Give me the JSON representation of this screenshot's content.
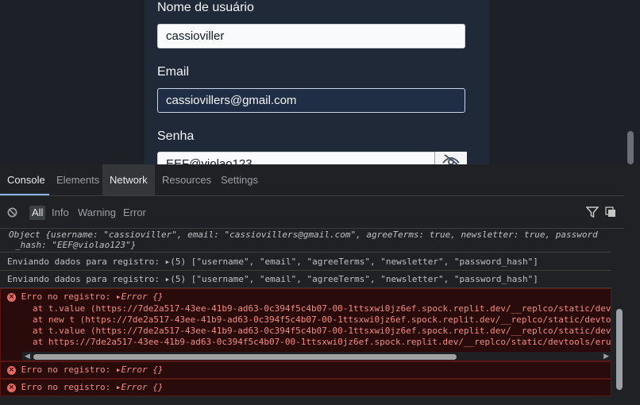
{
  "form": {
    "username_label": "Nome de usuário",
    "username_value": "cassioviller",
    "email_label": "Email",
    "email_value": "cassiovillers@gmail.com",
    "password_label": "Senha",
    "password_value": "EEF@violao123"
  },
  "devtools": {
    "tabs": [
      "Console",
      "Elements",
      "Network",
      "Resources",
      "Settings"
    ],
    "filters": [
      "All",
      "Info",
      "Warning",
      "Error"
    ],
    "logs": {
      "object_line1": "Object {username: \"cassioviller\", email: \"cassiovillers@gmail.com\", agreeTerms: true, newsletter: true, password",
      "object_line2": "_hash: \"EEF@violao123\"}",
      "send1": "Enviando dados para registro: ▸(5) [\"username\", \"email\", \"agreeTerms\", \"newsletter\", \"password_hash\"]",
      "send2": "Enviando dados para registro: ▸(5) [\"username\", \"email\", \"agreeTerms\", \"newsletter\", \"password_hash\"]",
      "error_label": "Erro no registro: ",
      "error_obj": "▸Error {}",
      "stack": [
        "at t.value (https://7de2a517-43ee-41b9-ad63-0c394f5c4b07-00-1ttsxwi0jz6ef.spock.replit.dev/__replco/static/dev",
        "at new t (https://7de2a517-43ee-41b9-ad63-0c394f5c4b07-00-1ttsxwi0jz6ef.spock.replit.dev/__replco/static/devto",
        "at t.value (https://7de2a517-43ee-41b9-ad63-0c394f5c4b07-00-1ttsxwi0jz6ef.spock.replit.dev/__replco/static/dev",
        "at https://7de2a517-43ee-41b9-ad63-0c394f5c4b07-00-1ttsxwi0jz6ef.spock.replit.dev/__replco/static/devtools/eru"
      ]
    }
  }
}
